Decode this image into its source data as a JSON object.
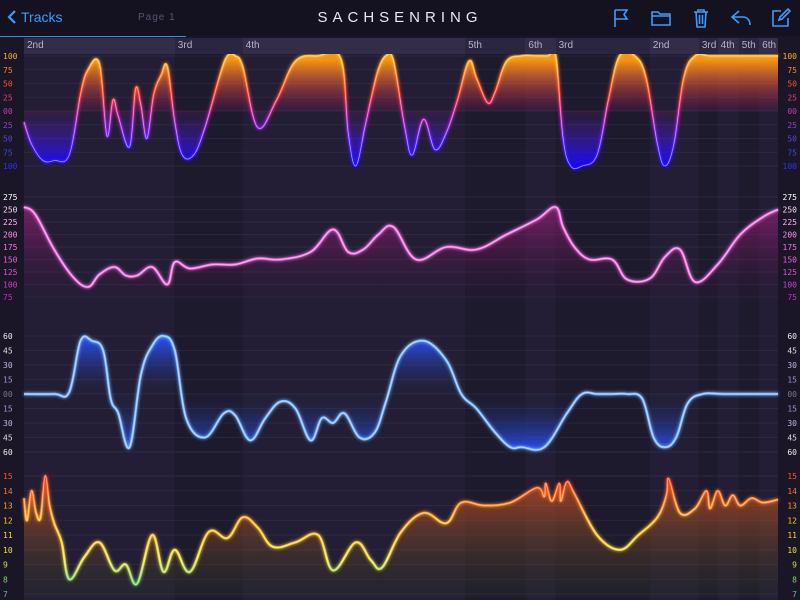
{
  "header": {
    "back_label": "Tracks",
    "page_label": "Page 1",
    "title": "SACHSENRING"
  },
  "toolbar": {
    "icons": [
      "flag-icon",
      "folder-icon",
      "trash-icon",
      "reply-icon",
      "compose-icon"
    ]
  },
  "colors": {
    "accent": "#3d9bff",
    "throttle_top": "#ffb020",
    "throttle_bottom": "#2a1aff",
    "speed": "#f060d8",
    "lateral": "#5aa8ff",
    "gear_trace": "#ffb020"
  },
  "gears": [
    {
      "label": "2nd",
      "x0": 0.0,
      "x1": 0.2
    },
    {
      "label": "3rd",
      "x0": 0.2,
      "x1": 0.29
    },
    {
      "label": "4th",
      "x0": 0.29,
      "x1": 0.585
    },
    {
      "label": "5th",
      "x0": 0.585,
      "x1": 0.665
    },
    {
      "label": "6th",
      "x0": 0.665,
      "x1": 0.705
    },
    {
      "label": "3rd",
      "x0": 0.705,
      "x1": 0.83
    },
    {
      "label": "2nd",
      "x0": 0.83,
      "x1": 0.895
    },
    {
      "label": "3rd",
      "x0": 0.895,
      "x1": 0.92
    },
    {
      "label": "4th",
      "x0": 0.92,
      "x1": 0.948
    },
    {
      "label": "5th",
      "x0": 0.948,
      "x1": 0.975
    },
    {
      "label": "6th",
      "x0": 0.975,
      "x1": 1.0
    }
  ],
  "chart_data": [
    {
      "type": "area",
      "ticks": [
        "100",
        "75",
        "50",
        "25",
        "00",
        "25",
        "50",
        "75",
        "100"
      ],
      "ylim": [
        -100,
        100
      ],
      "x": [
        0,
        0.01,
        0.025,
        0.04,
        0.06,
        0.075,
        0.085,
        0.1,
        0.11,
        0.118,
        0.125,
        0.14,
        0.148,
        0.155,
        0.163,
        0.172,
        0.182,
        0.19,
        0.2,
        0.21,
        0.225,
        0.24,
        0.26,
        0.27,
        0.28,
        0.29,
        0.31,
        0.335,
        0.36,
        0.39,
        0.42,
        0.43,
        0.44,
        0.452,
        0.46,
        0.47,
        0.48,
        0.49,
        0.505,
        0.515,
        0.53,
        0.545,
        0.56,
        0.575,
        0.59,
        0.6,
        0.615,
        0.625,
        0.64,
        0.66,
        0.68,
        0.695,
        0.705,
        0.715,
        0.725,
        0.74,
        0.76,
        0.775,
        0.79,
        0.81,
        0.825,
        0.84,
        0.85,
        0.862,
        0.875,
        0.89,
        0.91,
        0.94,
        0.97,
        1.0
      ],
      "values": [
        -20,
        -60,
        -90,
        -90,
        -80,
        30,
        75,
        85,
        -45,
        20,
        -10,
        -65,
        40,
        10,
        -50,
        30,
        65,
        80,
        -20,
        -80,
        -80,
        -30,
        65,
        100,
        100,
        80,
        -30,
        20,
        90,
        100,
        95,
        -40,
        -100,
        -30,
        20,
        75,
        100,
        90,
        -30,
        -80,
        -15,
        -70,
        -40,
        20,
        90,
        60,
        15,
        35,
        90,
        100,
        100,
        100,
        100,
        -50,
        -100,
        -100,
        -80,
        20,
        100,
        100,
        60,
        -60,
        -100,
        -60,
        60,
        100,
        100,
        100,
        100,
        100
      ],
      "series": [
        {
          "name": "",
          "values": []
        }
      ]
    },
    {
      "type": "line",
      "ticks": [
        "275",
        "250",
        "225",
        "200",
        "175",
        "150",
        "125",
        "100",
        "75"
      ],
      "ylim": [
        75,
        275
      ],
      "x": [
        0,
        0.015,
        0.04,
        0.065,
        0.085,
        0.1,
        0.12,
        0.135,
        0.15,
        0.17,
        0.19,
        0.2,
        0.22,
        0.25,
        0.28,
        0.31,
        0.34,
        0.38,
        0.41,
        0.43,
        0.45,
        0.47,
        0.49,
        0.52,
        0.56,
        0.6,
        0.64,
        0.68,
        0.705,
        0.715,
        0.73,
        0.75,
        0.78,
        0.8,
        0.83,
        0.85,
        0.87,
        0.89,
        0.92,
        0.95,
        0.98,
        1.0
      ],
      "values": [
        255,
        240,
        170,
        115,
        95,
        120,
        135,
        118,
        118,
        135,
        100,
        145,
        132,
        140,
        140,
        152,
        150,
        165,
        210,
        165,
        170,
        200,
        215,
        150,
        175,
        170,
        200,
        230,
        255,
        215,
        175,
        150,
        150,
        110,
        112,
        155,
        170,
        105,
        140,
        200,
        235,
        250
      ],
      "series": [
        {
          "name": "",
          "values": []
        }
      ]
    },
    {
      "type": "area",
      "ticks": [
        "60",
        "45",
        "30",
        "15",
        "00",
        "15",
        "30",
        "45",
        "60"
      ],
      "ylim": [
        -60,
        60
      ],
      "x": [
        0,
        0.04,
        0.06,
        0.075,
        0.09,
        0.105,
        0.115,
        0.125,
        0.14,
        0.155,
        0.17,
        0.185,
        0.2,
        0.215,
        0.24,
        0.265,
        0.28,
        0.3,
        0.32,
        0.34,
        0.36,
        0.38,
        0.395,
        0.41,
        0.425,
        0.445,
        0.465,
        0.48,
        0.5,
        0.53,
        0.56,
        0.58,
        0.6,
        0.625,
        0.645,
        0.66,
        0.69,
        0.72,
        0.74,
        0.76,
        0.78,
        0.8,
        0.82,
        0.835,
        0.85,
        0.865,
        0.88,
        0.9,
        0.93,
        1.0
      ],
      "values": [
        0,
        0,
        2,
        55,
        55,
        45,
        -5,
        -20,
        -55,
        20,
        50,
        60,
        45,
        -25,
        -45,
        -20,
        -22,
        -48,
        -25,
        -8,
        -15,
        -48,
        -25,
        -30,
        -20,
        -45,
        -40,
        -8,
        40,
        55,
        35,
        0,
        -15,
        -40,
        -55,
        -55,
        -55,
        -20,
        0,
        0,
        0,
        0,
        -5,
        -45,
        -55,
        -45,
        -10,
        0,
        0,
        0
      ],
      "series": [
        {
          "name": "",
          "values": []
        }
      ]
    },
    {
      "type": "line",
      "ticks": [
        "15",
        "14",
        "13",
        "12",
        "11",
        "10",
        "9",
        "8",
        "7"
      ],
      "ylim": [
        7,
        15
      ],
      "x": [
        0,
        0.004,
        0.01,
        0.016,
        0.022,
        0.028,
        0.034,
        0.04,
        0.05,
        0.06,
        0.08,
        0.1,
        0.12,
        0.135,
        0.15,
        0.17,
        0.185,
        0.2,
        0.22,
        0.245,
        0.27,
        0.29,
        0.31,
        0.33,
        0.36,
        0.39,
        0.41,
        0.44,
        0.46,
        0.475,
        0.5,
        0.53,
        0.56,
        0.58,
        0.61,
        0.645,
        0.68,
        0.69,
        0.692,
        0.7,
        0.71,
        0.712,
        0.72,
        0.73,
        0.76,
        0.79,
        0.815,
        0.84,
        0.852,
        0.855,
        0.87,
        0.89,
        0.905,
        0.91,
        0.92,
        0.93,
        0.94,
        0.95,
        0.965,
        0.98,
        1.0
      ],
      "values": [
        13.5,
        12,
        14,
        12.5,
        12.2,
        15,
        13,
        11.8,
        10.5,
        8,
        9.5,
        10.5,
        8.6,
        9,
        7.7,
        11,
        8.5,
        10,
        8.5,
        11.2,
        10.8,
        12.2,
        11.5,
        10.2,
        10.5,
        11,
        8.6,
        10.5,
        9.3,
        8.8,
        11.2,
        12.5,
        11.8,
        13.2,
        13,
        13.2,
        14.2,
        13.6,
        14.5,
        13.3,
        14.5,
        13.3,
        14.6,
        13.8,
        11,
        10,
        11,
        12.2,
        13.7,
        14.8,
        12.5,
        12.8,
        14,
        12.8,
        14,
        13,
        13.7,
        13,
        13.5,
        13.2,
        13.4
      ],
      "series": [
        {
          "name": "",
          "values": []
        }
      ]
    }
  ]
}
